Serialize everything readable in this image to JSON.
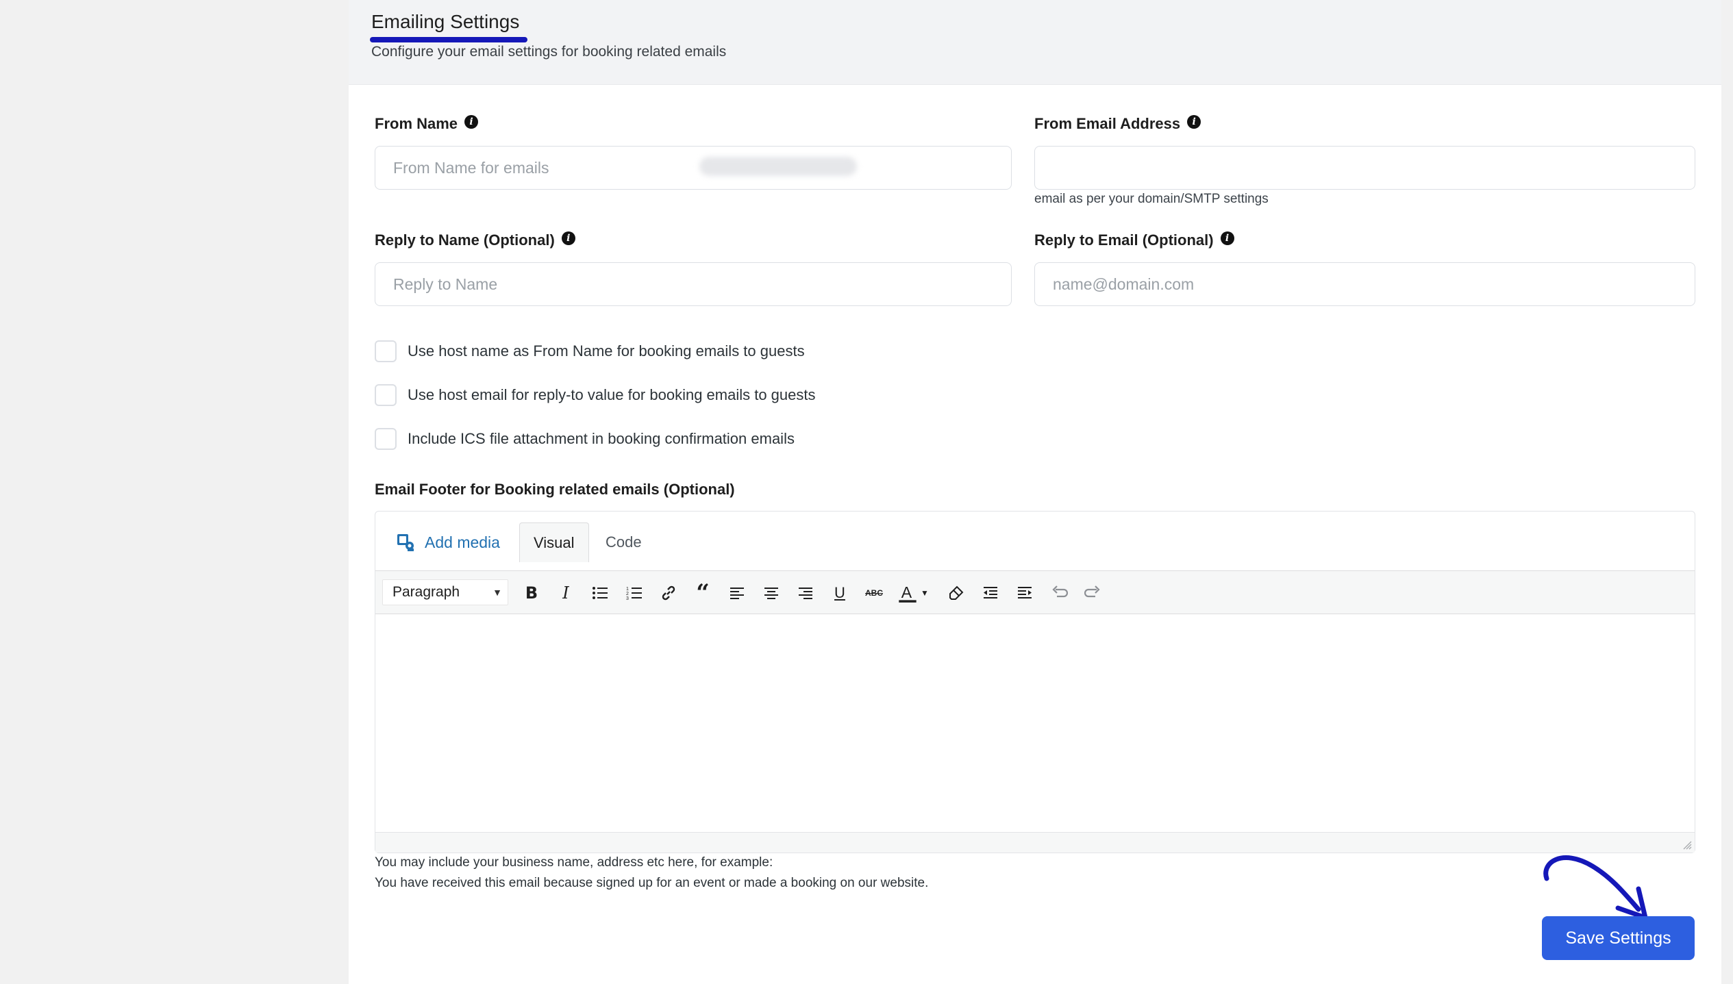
{
  "header": {
    "title": "Emailing Settings",
    "subtitle": "Configure your email settings for booking related emails"
  },
  "fields": {
    "from_name": {
      "label": "From Name",
      "placeholder": "From Name for emails",
      "value": ""
    },
    "from_email": {
      "label": "From Email Address",
      "help": "email as per your domain/SMTP settings"
    },
    "reply_name": {
      "label": "Reply to Name (Optional)",
      "placeholder": "Reply to Name",
      "value": ""
    },
    "reply_email": {
      "label": "Reply to Email (Optional)",
      "placeholder": "name@domain.com",
      "value": ""
    }
  },
  "checkboxes": [
    {
      "label": "Use host name as From Name for booking emails to guests",
      "checked": false
    },
    {
      "label": "Use host email for reply-to value for booking emails to guests",
      "checked": false
    },
    {
      "label": "Include ICS file attachment in booking confirmation emails",
      "checked": false
    }
  ],
  "editor": {
    "label": "Email Footer for Booking related emails (Optional)",
    "add_media": "Add media",
    "tab_visual": "Visual",
    "tab_code": "Code",
    "format": "Paragraph"
  },
  "footer_note": {
    "line1": "You may include your business name, address etc here, for example:",
    "line2": "You have received this email because signed up for an event or made a booking on our website."
  },
  "actions": {
    "save": "Save Settings"
  },
  "colors": {
    "accent": "#2d5fe0",
    "underline": "#1518b8",
    "link": "#2271b1"
  }
}
